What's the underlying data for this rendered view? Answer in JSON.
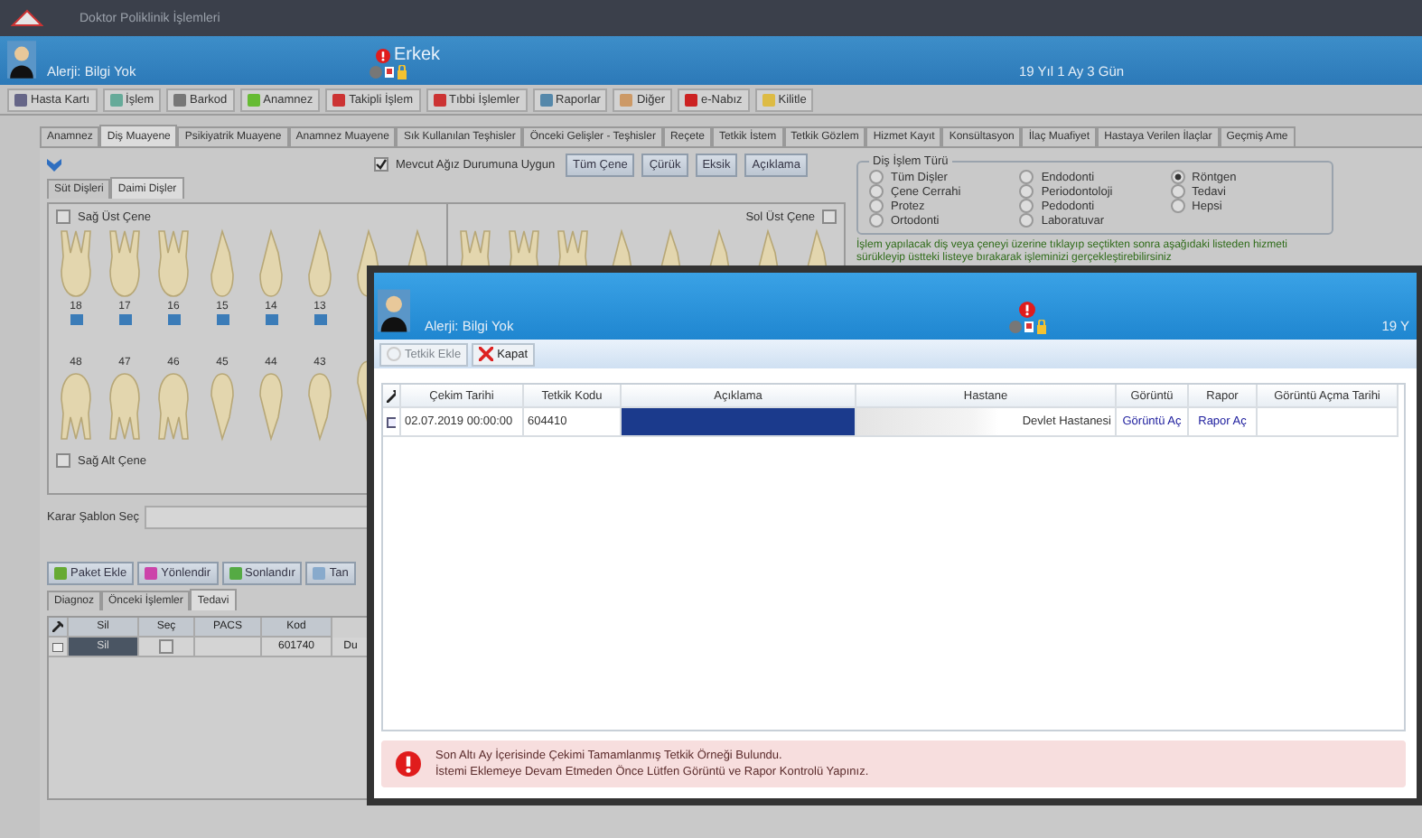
{
  "window": {
    "title": "Doktor Poliklinik İşlemleri"
  },
  "patient": {
    "allergy": "Alerji: Bilgi Yok",
    "gender": "Erkek",
    "age": "19 Yıl 1 Ay 3 Gün"
  },
  "toolbar": [
    "Hasta Kartı",
    "İşlem",
    "Barkod",
    "Anamnez",
    "Takipli İşlem",
    "Tıbbi İşlemler",
    "Raporlar",
    "Diğer",
    "e-Nabız",
    "Kilitle"
  ],
  "tabs": [
    {
      "label": "Anamnez",
      "selected": false
    },
    {
      "label": "Diş Muayene",
      "selected": true
    },
    {
      "label": "Psikiyatrik Muayene",
      "selected": false
    },
    {
      "label": "Anamnez Muayene",
      "selected": false
    },
    {
      "label": "Sık Kullanılan Teşhisler",
      "selected": false
    },
    {
      "label": "Önceki Gelişler - Teşhisler",
      "selected": false
    },
    {
      "label": "Reçete",
      "selected": false
    },
    {
      "label": "Tetkik İstem",
      "selected": false
    },
    {
      "label": "Tetkik Gözlem",
      "selected": false
    },
    {
      "label": "Hizmet Kayıt",
      "selected": false
    },
    {
      "label": "Konsültasyon",
      "selected": false
    },
    {
      "label": "İlaç Muafiyet",
      "selected": false
    },
    {
      "label": "Hastaya Verilen İlaçlar",
      "selected": false
    },
    {
      "label": "Geçmiş Ame",
      "selected": false
    }
  ],
  "dental": {
    "subtabs": [
      {
        "label": "Süt Dişleri",
        "selected": false
      },
      {
        "label": "Daimi Dişler",
        "selected": true
      }
    ],
    "fit_current": {
      "label": "Mevcut Ağız Durumuna Uygun",
      "checked": true
    },
    "jaw_buttons": [
      "Tüm Çene",
      "Çürük",
      "Eksik",
      "Açıklama"
    ],
    "upper_right": {
      "label": "Sağ Üst Çene",
      "checked": false,
      "teeth": [
        "18",
        "17",
        "16",
        "15",
        "14",
        "13"
      ]
    },
    "upper_left": {
      "label": "Sol Üst Çene",
      "checked": false
    },
    "lower_right": {
      "label": "Sağ Alt Çene",
      "checked": false,
      "teeth": [
        "48",
        "47",
        "46",
        "45",
        "44",
        "43"
      ]
    },
    "template": {
      "label": "Karar Şablon Seç"
    },
    "action_buttons": [
      "Paket Ekle",
      "Yönlendir",
      "Sonlandır",
      "Tan"
    ],
    "bottom_tabs": [
      {
        "label": "Diagnoz",
        "selected": false
      },
      {
        "label": "Önceki İşlemler",
        "selected": false
      },
      {
        "label": "Tedavi",
        "selected": true
      }
    ],
    "grid": {
      "columns": [
        "Sil",
        "Seç",
        "PACS",
        "Kod"
      ],
      "rows": [
        {
          "delete": "Sil",
          "checked": false,
          "code": "601740",
          "column_5": "Du"
        }
      ]
    }
  },
  "procedure_type": {
    "title": "Diş İşlem Türü",
    "options": [
      {
        "label": "Tüm Dişler",
        "selected": false
      },
      {
        "label": "Çene Cerrahi",
        "selected": false
      },
      {
        "label": "Protez",
        "selected": false
      },
      {
        "label": "Ortodonti",
        "selected": false
      },
      {
        "label": "Endodonti",
        "selected": false
      },
      {
        "label": "Periodontoloji",
        "selected": false
      },
      {
        "label": "Pedodonti",
        "selected": false
      },
      {
        "label": "Laboratuvar",
        "selected": false
      },
      {
        "label": "Röntgen",
        "selected": true
      },
      {
        "label": "Tedavi",
        "selected": false
      },
      {
        "label": "Hepsi",
        "selected": false
      }
    ]
  },
  "hint": "İşlem yapılacak diş veya çeneyi üzerine tıklayıp seçtikten sonra aşağıdaki listeden hizmeti sürükleyip üstteki listeye bırakarak işleminizi gerçekleştirebilirsiniz",
  "dialog": {
    "allergy": "Alerji: Bilgi Yok",
    "age": "19 Y",
    "buttons": [
      {
        "label": "Tetkik Ekle",
        "disabled": true
      },
      {
        "label": "Kapat",
        "disabled": false
      }
    ],
    "columns": [
      "Çekim Tarihi",
      "Tetkik Kodu",
      "Açıklama",
      "Hastane",
      "Görüntü",
      "Rapor",
      "Görüntü Açma Tarihi"
    ],
    "rows": [
      {
        "date": "02.07.2019 00:00:00",
        "code": "604410",
        "hospital": "Devlet Hastanesi",
        "image_link": "Görüntü Aç",
        "report_link": "Rapor Aç"
      }
    ],
    "warning": [
      "Son Altı Ay İçerisinde Çekimi Tamamlanmış Tetkik Örneği Bulundu.",
      "İstemi Eklemeye Devam Etmeden Önce Lütfen Görüntü ve Rapor Kontrolü Yapınız."
    ]
  }
}
